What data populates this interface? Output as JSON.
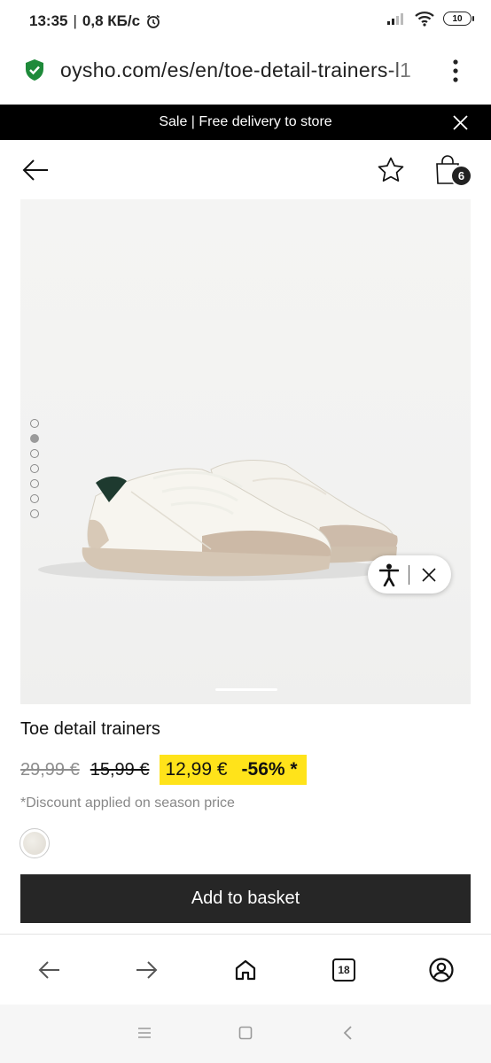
{
  "status_bar": {
    "time": "13:35",
    "speed": "0,8 КБ/с",
    "battery": "10"
  },
  "browser": {
    "url": "oysho.com/es/en/toe-detail-trainers-l1",
    "tabs_count": "18"
  },
  "banner": {
    "text": "Sale | Free delivery to store"
  },
  "header": {
    "bag_count": "6"
  },
  "gallery": {
    "dot_count": 7,
    "active_index": 1
  },
  "product": {
    "title": "Toe detail trainers",
    "original_price": "29,99 €",
    "season_price": "15,99 €",
    "current_price": "12,99 €",
    "discount": "-56% *",
    "discount_note": "*Discount applied on season price",
    "add_button_label": "Add to basket"
  },
  "colors": {
    "highlight": "#ffe31a",
    "button_bg": "#262626",
    "banner_bg": "#000000",
    "secure_green": "#1e8a3a"
  }
}
